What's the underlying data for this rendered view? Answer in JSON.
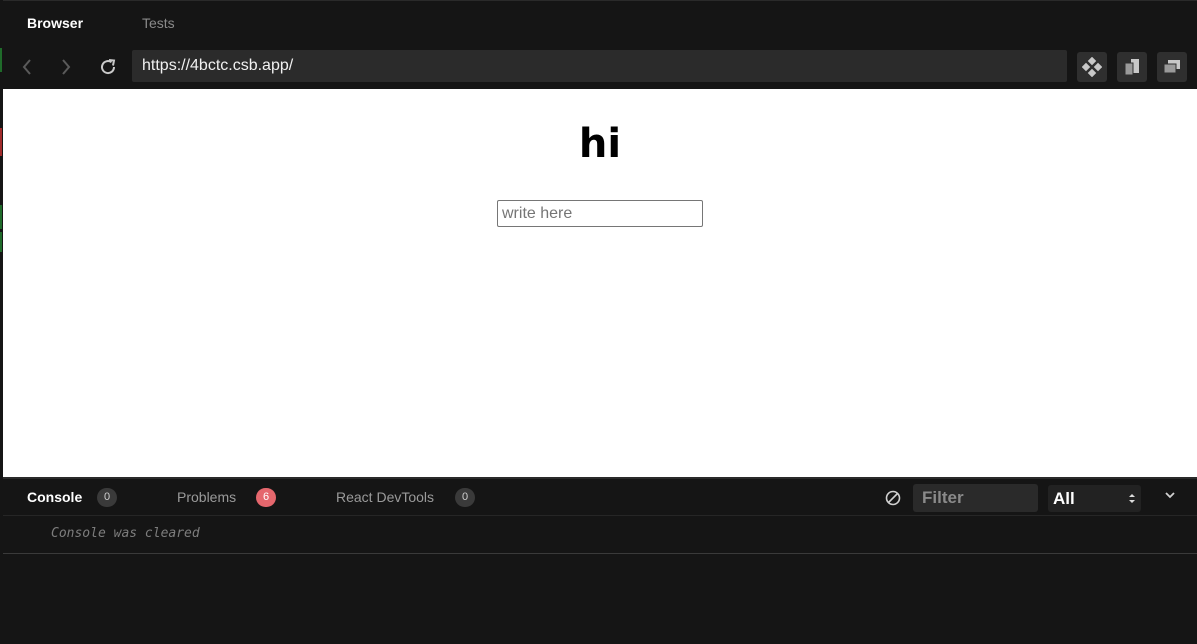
{
  "top_tabs": {
    "browser": "Browser",
    "tests": "Tests"
  },
  "address_bar": {
    "url": "https://4bctc.csb.app/"
  },
  "preview": {
    "heading": "hi",
    "input_placeholder": "write here",
    "input_value": ""
  },
  "devtools": {
    "tabs": [
      {
        "label": "Console",
        "count": "0"
      },
      {
        "label": "Problems",
        "count": "6"
      },
      {
        "label": "React DevTools",
        "count": "0"
      }
    ],
    "filter_placeholder": "Filter",
    "level_selected": "All",
    "console_message": "Console was cleared"
  },
  "colors": {
    "background": "#151515",
    "problems_badge": "#e5676d",
    "url_field": "#2b2b2b"
  },
  "icons": [
    "back-arrow-icon",
    "forward-arrow-icon",
    "reload-icon",
    "devtools-diamond-icon",
    "copy-icon",
    "window-icon",
    "clear-console-icon",
    "chevron-down-icon"
  ]
}
